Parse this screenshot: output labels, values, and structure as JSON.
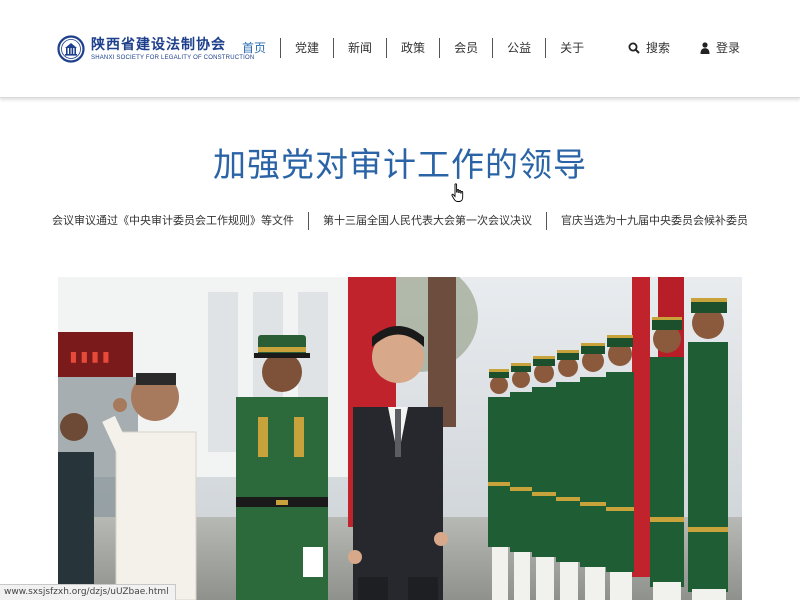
{
  "header": {
    "logo_cn": "陕西省建设法制协会",
    "logo_en": "SHANXI SOCIETY FOR LEGALITY OF CONSTRUCTION",
    "brand_color": "#1d3f8c"
  },
  "nav": {
    "items": [
      "首页",
      "党建",
      "新闻",
      "政策",
      "会员",
      "公益",
      "关于"
    ],
    "active_index": 0,
    "active_color": "#2b6cb0"
  },
  "tools": {
    "search_label": "搜索",
    "search_icon": "search-icon",
    "login_label": "登录",
    "login_icon": "user-icon"
  },
  "main": {
    "headline": "加强党对审计工作的领导",
    "headline_color": "#2a64a6",
    "sublinks": [
      "会议审议通过《中央审计委员会工作规则》等文件",
      "第十三届全国人民代表大会第一次会议决议",
      "官庆当选为十九届中央委员会候补委员"
    ]
  },
  "status": {
    "url": "www.sxsjsfzxh.org/dzjs/uUZbae.html"
  }
}
